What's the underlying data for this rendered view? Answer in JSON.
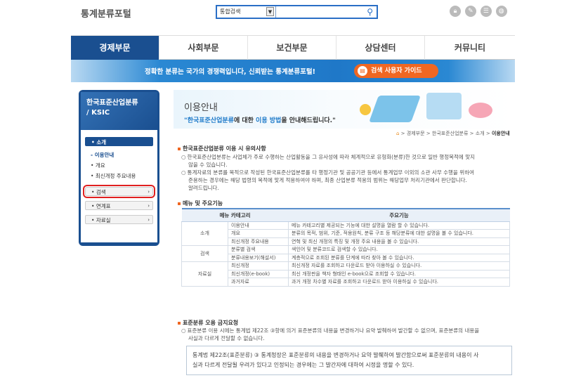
{
  "header": {
    "site_title": "통계분류포털",
    "search": {
      "scope": "통합검색",
      "value": "",
      "placeholder": ""
    },
    "util_icons": [
      "lock-icon",
      "edit-icon",
      "list-icon",
      "globe-icon"
    ]
  },
  "gnb": {
    "items": [
      {
        "label": "경제부문",
        "active": true
      },
      {
        "label": "사회부문",
        "active": false
      },
      {
        "label": "보건부문",
        "active": false
      },
      {
        "label": "상담센터",
        "active": false
      },
      {
        "label": "커뮤니티",
        "active": false
      }
    ]
  },
  "banner": {
    "text": "정확한 분류는 국가의 경쟁력입니다, 신뢰받는 통계분류포털!",
    "guide_label": "검색 사용자 가이드"
  },
  "sidebar": {
    "title_line1": "한국표준산업분류",
    "title_line2": "/ KSIC",
    "menu": {
      "intro": "소개",
      "intro_subs": [
        "이용안내",
        "개요",
        "최신개정 주요내용"
      ],
      "search": "검색",
      "link": "연계표",
      "data": "자료실"
    }
  },
  "visual": {
    "title": "이용안내",
    "sub_highlight": "\"한국표준산업분류",
    "sub_mid": "에 대한 ",
    "sub_highlight2": "이용 방법",
    "sub_rest": "을 안내해드립니다.\""
  },
  "location": {
    "items": [
      "경제부문",
      "한국표준산업분류",
      "소개"
    ],
    "current": "이용안내"
  },
  "section1": {
    "title": "한국표준산업분류 이용 시 유의사항",
    "p1_line1": "한국표준산업분류는 사업체가 주로 수행하는 산업활동을 그 유사성에 따라 체계적으로 유형화(분류)한 것으로 일반 행정목적에 맞지",
    "p1_line2": "않을 수 있습니다.",
    "p2_line1": "통계자료의 분류를 목적으로 작성된 한국표준산업분류를 타 행정기관 및 공공기관 등에서 통계업무 이외의 소관 사무 수행을 위하여",
    "p2_line2": "준용하는 경우에는 해당 법령의 목적에 맞게 적용하여야 하며, 최종 산업분류 적용의 범위는 해당업무 처리기관에서 판단합니다.",
    "p2_line3": "알려드립니다."
  },
  "section2": {
    "title": "메뉴 및 주요기능",
    "headers": [
      "메뉴 카테고리",
      "주요기능"
    ],
    "groups": [
      {
        "category": "소개",
        "rows": [
          {
            "menu": "이용안내",
            "desc": "메뉴 카테고리별 제공되는 기능에 대한 설명을 열람 할 수 있습니다."
          },
          {
            "menu": "개요",
            "desc": "분류의 목적, 범위, 기준, 적용원칙, 분류 구조 등 해당분류에 대한 설명을 볼 수 있습니다."
          },
          {
            "menu": "최신개정 주요내용",
            "desc": "연혁 및 최신 개정의 특징 및 개정 주요 내용을 볼 수 있습니다."
          }
        ]
      },
      {
        "category": "검색",
        "rows": [
          {
            "menu": "분류별 검색",
            "desc": "색인어 및 분류코드로 검색할 수 있습니다."
          },
          {
            "menu": "분류내용보기(해설서)",
            "desc": "계층적으로 조회된 분류를 단계에 따라 찾아 볼 수 있습니다."
          }
        ]
      },
      {
        "category": "자료실",
        "rows": [
          {
            "menu": "최신개정",
            "desc": "최신개정 자료를 조회하고 다운로드 받아 이용하실 수 있습니다."
          },
          {
            "menu": "최신개정(e-book)",
            "desc": "최신 개정판을 책자 형태인 e-book으로 조회할 수 있습니다."
          },
          {
            "menu": "과거자료",
            "desc": "과거 개정 차수별 자료를 조회하고 다운로드 받아 이용하실 수 있습니다."
          }
        ]
      }
    ]
  },
  "section3": {
    "title": "표준분류 오용 금지요청",
    "p1_line1": "표준분류 이용 시에는 통계법 제22조 ③항에 의거 표준분류의 내용을 변경하거나 요약 발췌하여 발간할 수 없으며, 표준분류의 내용을",
    "p1_line2": "사실과 다르게 전달할 수 없습니다.",
    "box_line1": "통계법 제22조(표준분류) ③ 통계청장은 표준분류의 내용을 변경하거나 요약 발췌하여 발간함으로써 표준분류의 내용이 사",
    "box_line2": "실과 다르게 전달될 우려가 있다고 인정되는 경우에는 그 발간자에 대하여 시정을 명할 수 있다."
  }
}
